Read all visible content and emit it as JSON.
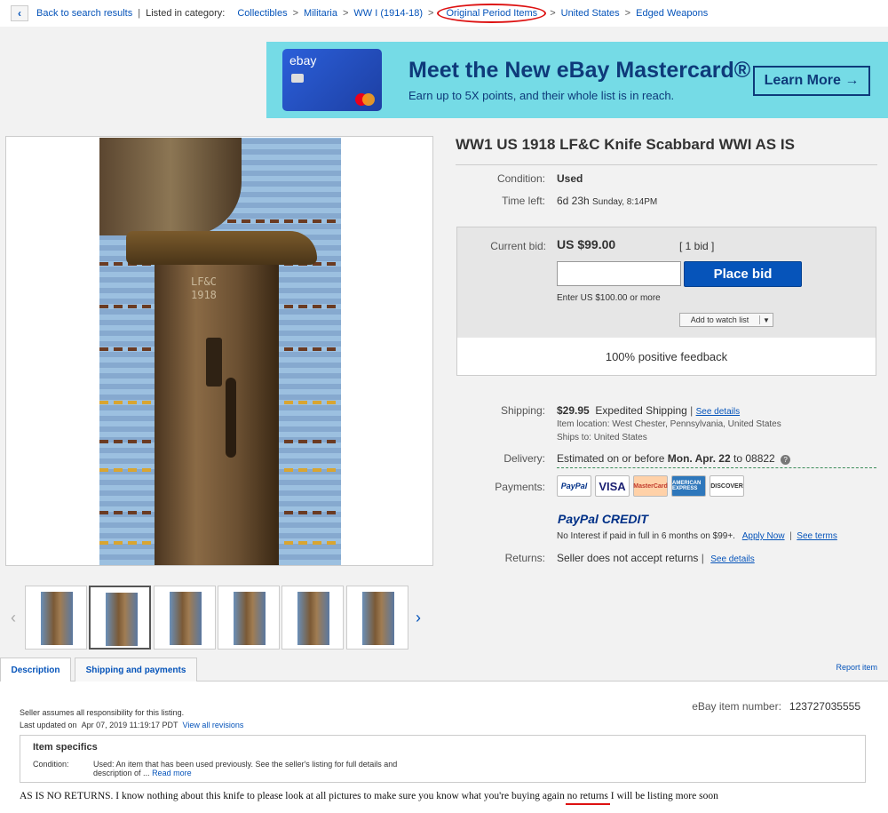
{
  "breadcrumb": {
    "back_label": "Back to search results",
    "listed_label": "Listed in category:",
    "categories": [
      "Collectibles",
      "Militaria",
      "WW I (1914-18)",
      "Original Period Items",
      "United States",
      "Edged Weapons"
    ],
    "separator": ">"
  },
  "banner": {
    "card_brand": "ebay",
    "title": "Meet the New eBay Mastercard®",
    "subtitle": "Earn up to 5X points, and their whole list is in reach.",
    "button": "Learn More →",
    "background": "#75dbe6"
  },
  "listing": {
    "title": "WW1 US 1918 LF&C Knife Scabbard WWI AS IS",
    "image_marking": [
      "LF&C",
      "1918"
    ],
    "condition_label": "Condition:",
    "condition": "Used",
    "time_left_label": "Time left:",
    "time_left": "6d 23h",
    "end_time": "Sunday, 8:14PM"
  },
  "bid": {
    "current_label": "Current bid:",
    "price": "US $99.00",
    "bids": "[ 1 bid ]",
    "input_value": "",
    "place_bid": "Place bid",
    "hint": "Enter US $100.00 or more",
    "watch": "Add to watch list",
    "feedback": "100% positive feedback"
  },
  "shipping": {
    "label": "Shipping:",
    "price": "$29.95",
    "method": "Expedited Shipping",
    "details_link": "See details",
    "location": "Item location:  West Chester, Pennsylvania, United States",
    "ships_to": "Ships to:  United States"
  },
  "delivery": {
    "label": "Delivery:",
    "prefix": "Estimated on or before",
    "date": "Mon. Apr. 22",
    "suffix": "to 08822"
  },
  "payments": {
    "label": "Payments:",
    "methods": [
      "PayPal",
      "VISA",
      "MasterCard",
      "AMERICAN EXPRESS",
      "DISCOVER"
    ],
    "credit_logo": "PayPal CREDIT",
    "credit_text": "No Interest if paid in full in 6 months on $99+.",
    "apply_link": "Apply Now",
    "terms_link": "See terms"
  },
  "returns": {
    "label": "Returns:",
    "text": "Seller does not accept returns",
    "details_link": "See details"
  },
  "tabs": [
    "Description",
    "Shipping and payments"
  ],
  "report_link": "Report item",
  "description": {
    "responsibility": "Seller assumes all responsibility for this listing.",
    "last_updated_label": "Last updated on",
    "last_updated": "Apr 07, 2019 11:19:17 PDT",
    "revisions_link": "View all revisions",
    "item_number_label": "eBay item number:",
    "item_number": "123727035555",
    "specs_title": "Item specifics",
    "specs_condition_label": "Condition:",
    "specs_condition": "Used: An item that has been used previously. See the seller's listing for full details and description of ...",
    "read_more": "Read more",
    "text_before": "AS IS NO RETURNS. I know nothing about this knife to please look at all pictures to make sure you know what you're buying again",
    "text_highlight": "no returns",
    "text_after": "I will be listing more soon"
  },
  "colors": {
    "link": "#0654ba",
    "primary_button": "#0654ba",
    "annotation": "#dd1111"
  }
}
